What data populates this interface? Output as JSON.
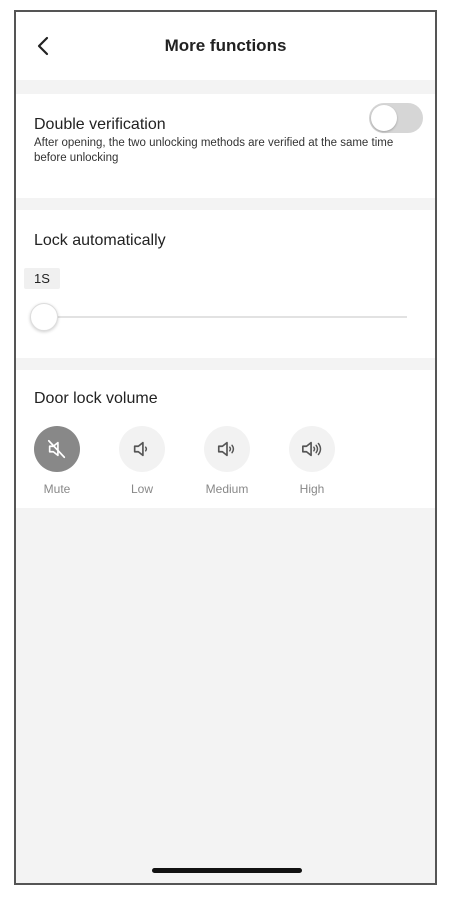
{
  "header": {
    "title": "More functions",
    "back_icon": "chevron-left-icon"
  },
  "double_verification": {
    "title": "Double verification",
    "description": "After opening, the two unlocking methods are verified at the same time before unlocking",
    "enabled": false
  },
  "lock_automatically": {
    "title": "Lock automatically",
    "value_label": "1S",
    "slider_fraction": 0
  },
  "door_lock_volume": {
    "title": "Door lock volume",
    "options": [
      {
        "label": "Mute",
        "icon": "speaker-mute-icon",
        "selected": true
      },
      {
        "label": "Low",
        "icon": "speaker-low-icon",
        "selected": false
      },
      {
        "label": "Medium",
        "icon": "speaker-medium-icon",
        "selected": false
      },
      {
        "label": "High",
        "icon": "speaker-high-icon",
        "selected": false
      }
    ]
  },
  "colors": {
    "selected_volume": "#888888",
    "toggle_off": "#d6d6d6",
    "page_background": "#f3f3f3"
  }
}
